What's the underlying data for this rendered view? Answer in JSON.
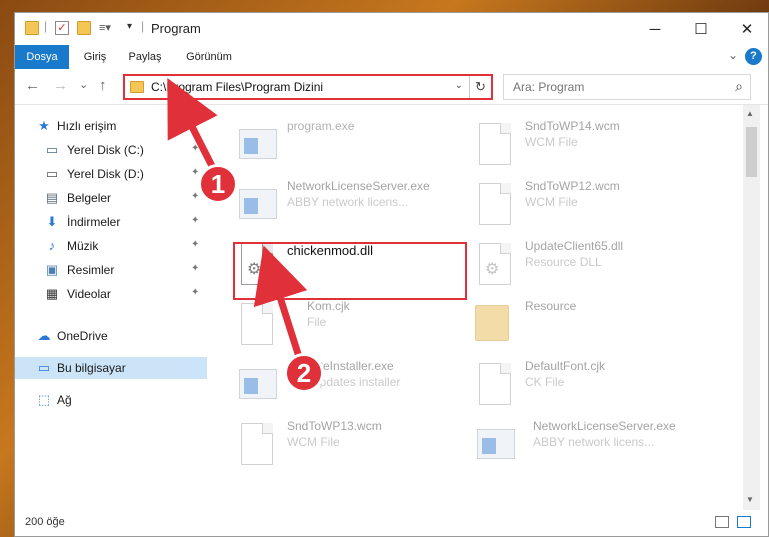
{
  "window": {
    "title": "Program",
    "minimize": "─",
    "maximize": "☐",
    "close": "✕"
  },
  "ribbon": {
    "tabs": [
      {
        "label": "Dosya",
        "active": true
      },
      {
        "label": "Giriş"
      },
      {
        "label": "Paylaş"
      },
      {
        "label": "Görünüm"
      }
    ],
    "help": "?"
  },
  "nav": {
    "back": "←",
    "forward": "→",
    "recent": "⌄",
    "up": "↑",
    "address": "C:\\Program Files\\Program Dizini",
    "refresh": "↻",
    "dropdown": "⌄",
    "search_placeholder": "Ara: Program",
    "search_icon": "⌕"
  },
  "sidebar": {
    "items": [
      {
        "label": "Hızlı erişim",
        "icon": "star-icon",
        "glyph": "★",
        "color": "#2b78d6"
      },
      {
        "label": "Yerel Disk (C:)",
        "icon": "drive-icon",
        "glyph": "▭",
        "color": "#4a6e8a",
        "pinned": true
      },
      {
        "label": "Yerel Disk (D:)",
        "icon": "drive-icon",
        "glyph": "▭",
        "color": "#555555",
        "pinned": true
      },
      {
        "label": "Belgeler",
        "icon": "documents-icon",
        "glyph": "▤",
        "color": "#5b6b7b",
        "pinned": true
      },
      {
        "label": "İndirmeler",
        "icon": "download-icon",
        "glyph": "⬇",
        "color": "#2b78d6",
        "pinned": true
      },
      {
        "label": "Müzik",
        "icon": "music-icon",
        "glyph": "♪",
        "color": "#2b78d6",
        "pinned": true
      },
      {
        "label": "Resimler",
        "icon": "pictures-icon",
        "glyph": "▣",
        "color": "#4a7fb0",
        "pinned": true
      },
      {
        "label": "Videolar",
        "icon": "videos-icon",
        "glyph": "▦",
        "color": "#333333",
        "pinned": true
      },
      {
        "label": "OneDrive",
        "icon": "cloud-icon",
        "glyph": "☁",
        "color": "#2b78d6"
      },
      {
        "label": "Bu bilgisayar",
        "icon": "computer-icon",
        "glyph": "▭",
        "color": "#2b78d6",
        "selected": true
      },
      {
        "label": "Ağ",
        "icon": "network-icon",
        "glyph": "⬚",
        "color": "#2b78d6"
      }
    ],
    "pin_glyph": "📌"
  },
  "files": [
    {
      "name": "program.exe",
      "type": "",
      "icon": "installer-icon"
    },
    {
      "name": "SndToWP14.wcm",
      "type": "WCM File",
      "icon": "file-icon"
    },
    {
      "name": "NetworkLicenseServer.exe",
      "type": "ABBY network licens...",
      "icon": "exe-icon"
    },
    {
      "name": "SndToWP12.wcm",
      "type": "WCM File",
      "icon": "file-icon"
    },
    {
      "name": "chickenmod.dll",
      "type": "",
      "icon": "dll-icon"
    },
    {
      "name": "UpdateClient65.dll",
      "type": "Resource DLL",
      "icon": "dll-icon"
    },
    {
      "name": "Kom.cjk",
      "type": "File",
      "icon": "file-icon"
    },
    {
      "name": "Resource",
      "type": "",
      "icon": "folder-icon"
    },
    {
      "name": "ateInstaller.exe",
      "type": "updates installer",
      "icon": "exe-icon"
    },
    {
      "name": "DefaultFont.cjk",
      "type": "CK File",
      "icon": "file-icon"
    },
    {
      "name": "SndToWP13.wcm",
      "type": "WCM File",
      "icon": "file-icon"
    },
    {
      "name": "NetworkLicenseServer.exe",
      "type": "ABBY network licens...",
      "icon": "exe-icon"
    }
  ],
  "annotations": {
    "step1": "1",
    "step2": "2"
  },
  "status": {
    "count": "200 öğe"
  },
  "colors": {
    "accent": "#1979ca",
    "annotation": "#e0303a",
    "selected": "#cce4f7"
  }
}
